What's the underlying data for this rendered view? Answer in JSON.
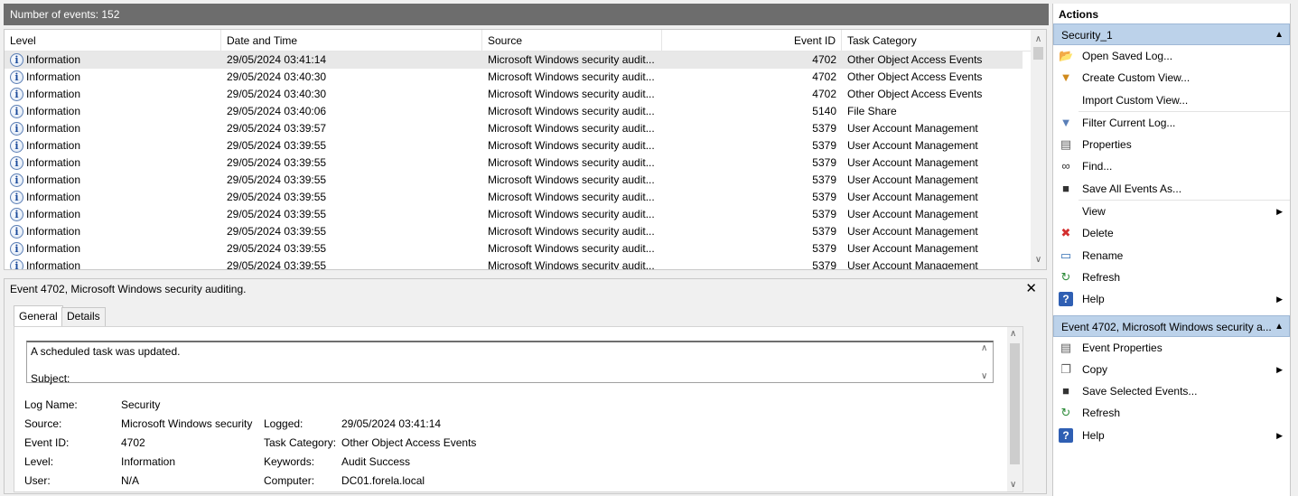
{
  "count_bar": "Number of events: 152",
  "columns": [
    "Level",
    "Date and Time",
    "Source",
    "Event ID",
    "Task Category"
  ],
  "events": [
    {
      "level": "Information",
      "date": "29/05/2024 03:41:14",
      "source": "Microsoft Windows security audit...",
      "id": "4702",
      "category": "Other Object Access Events"
    },
    {
      "level": "Information",
      "date": "29/05/2024 03:40:30",
      "source": "Microsoft Windows security audit...",
      "id": "4702",
      "category": "Other Object Access Events"
    },
    {
      "level": "Information",
      "date": "29/05/2024 03:40:30",
      "source": "Microsoft Windows security audit...",
      "id": "4702",
      "category": "Other Object Access Events"
    },
    {
      "level": "Information",
      "date": "29/05/2024 03:40:06",
      "source": "Microsoft Windows security audit...",
      "id": "5140",
      "category": "File Share"
    },
    {
      "level": "Information",
      "date": "29/05/2024 03:39:57",
      "source": "Microsoft Windows security audit...",
      "id": "5379",
      "category": "User Account Management"
    },
    {
      "level": "Information",
      "date": "29/05/2024 03:39:55",
      "source": "Microsoft Windows security audit...",
      "id": "5379",
      "category": "User Account Management"
    },
    {
      "level": "Information",
      "date": "29/05/2024 03:39:55",
      "source": "Microsoft Windows security audit...",
      "id": "5379",
      "category": "User Account Management"
    },
    {
      "level": "Information",
      "date": "29/05/2024 03:39:55",
      "source": "Microsoft Windows security audit...",
      "id": "5379",
      "category": "User Account Management"
    },
    {
      "level": "Information",
      "date": "29/05/2024 03:39:55",
      "source": "Microsoft Windows security audit...",
      "id": "5379",
      "category": "User Account Management"
    },
    {
      "level": "Information",
      "date": "29/05/2024 03:39:55",
      "source": "Microsoft Windows security audit...",
      "id": "5379",
      "category": "User Account Management"
    },
    {
      "level": "Information",
      "date": "29/05/2024 03:39:55",
      "source": "Microsoft Windows security audit...",
      "id": "5379",
      "category": "User Account Management"
    },
    {
      "level": "Information",
      "date": "29/05/2024 03:39:55",
      "source": "Microsoft Windows security audit...",
      "id": "5379",
      "category": "User Account Management"
    },
    {
      "level": "Information",
      "date": "29/05/2024 03:39:55",
      "source": "Microsoft Windows security audit...",
      "id": "5379",
      "category": "User Account Management"
    }
  ],
  "detail": {
    "title": "Event 4702, Microsoft Windows security auditing.",
    "tabs": [
      "General",
      "Details"
    ],
    "message_line1": "A scheduled task was updated.",
    "message_line2": "Subject:",
    "fields": {
      "log_name_label": "Log Name:",
      "log_name": "Security",
      "source_label": "Source:",
      "source": "Microsoft Windows security",
      "logged_label": "Logged:",
      "logged": "29/05/2024 03:41:14",
      "event_id_label": "Event ID:",
      "event_id": "4702",
      "task_category_label": "Task Category:",
      "task_category": "Other Object Access Events",
      "level_label": "Level:",
      "level": "Information",
      "keywords_label": "Keywords:",
      "keywords": "Audit Success",
      "user_label": "User:",
      "user": "N/A",
      "computer_label": "Computer:",
      "computer": "DC01.forela.local"
    }
  },
  "actions": {
    "title": "Actions",
    "section1": "Security_1",
    "items1": [
      {
        "label": "Open Saved Log...",
        "icon": "folder-icon"
      },
      {
        "label": "Create Custom View...",
        "icon": "filter-create-icon"
      },
      {
        "label": "Import Custom View...",
        "icon": ""
      },
      {
        "label": "Filter Current Log...",
        "icon": "filter-icon"
      },
      {
        "label": "Properties",
        "icon": "properties-icon"
      },
      {
        "label": "Find...",
        "icon": "binoculars-icon"
      },
      {
        "label": "Save All Events As...",
        "icon": "save-icon"
      },
      {
        "label": "View",
        "icon": "",
        "submenu": true
      },
      {
        "label": "Delete",
        "icon": "delete-icon"
      },
      {
        "label": "Rename",
        "icon": "rename-icon"
      },
      {
        "label": "Refresh",
        "icon": "refresh-icon"
      },
      {
        "label": "Help",
        "icon": "help-icon",
        "submenu": true
      }
    ],
    "section2": "Event 4702, Microsoft Windows security a...",
    "items2": [
      {
        "label": "Event Properties",
        "icon": "properties-icon"
      },
      {
        "label": "Copy",
        "icon": "copy-icon",
        "submenu": true
      },
      {
        "label": "Save Selected Events...",
        "icon": "save-icon"
      },
      {
        "label": "Refresh",
        "icon": "refresh-icon"
      },
      {
        "label": "Help",
        "icon": "help-icon",
        "submenu": true
      }
    ]
  }
}
